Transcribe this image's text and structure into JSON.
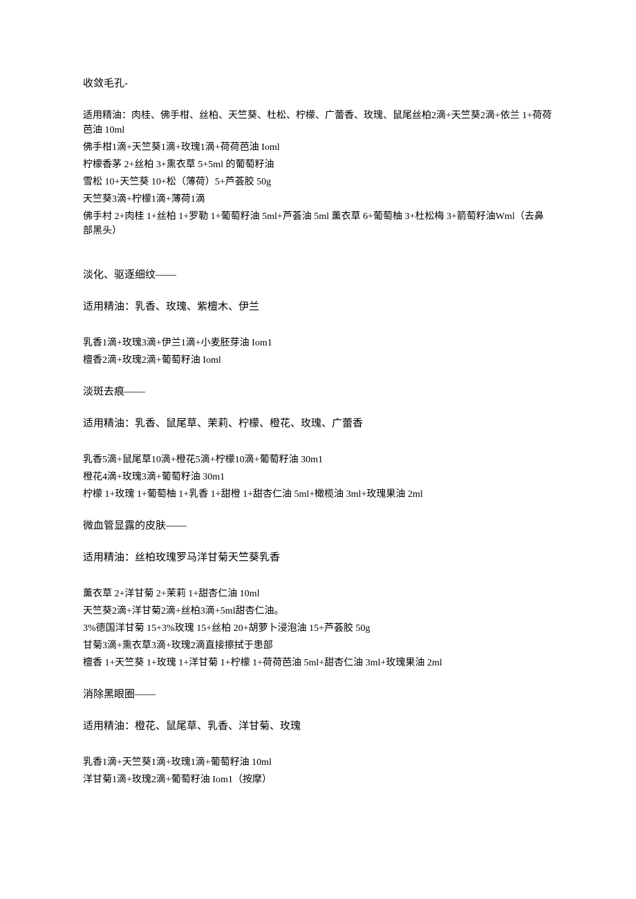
{
  "sections": [
    {
      "title": "收敛毛孔-",
      "intro": "适用精油：肉桂、佛手柑、丝柏、天竺葵、杜松、柠檬、广蕾香、玫瑰、鼠尾丝柏2滴+天竺葵2滴+依兰 1+荷荷芭油 10ml",
      "lines": [
        "佛手柑1滴+天竺葵1滴+玫瑰1滴+荷荷芭油 Ioml",
        "柠檬香茅 2+丝柏 3+熏衣草 5+5ml 的葡萄籽油",
        "雪松 10+天竺葵 10+松（薄荷）5+芦荟胶 50g",
        "天竺葵3滴+柠檬1滴+薄荷1滴",
        "佛手村 2+肉桂 1+丝柏 1+罗勒 1+葡萄籽油 5ml+芦荟油 5ml 薰衣草 6+葡萄柚 3+杜松梅 3+箭萄籽油Wml（去鼻部黑头）"
      ]
    },
    {
      "title": "淡化、驱逐细纹——",
      "intro": "适用精油：乳香、玫瑰、紫檀木、伊兰",
      "intro_spaced": true,
      "lines": [
        "乳香1滴+玫瑰3滴+伊兰1滴+小麦胚芽油 Iom1",
        "檀香2滴+玫瑰2滴+葡萄籽油 Ioml"
      ]
    },
    {
      "title": "淡斑去痕——",
      "intro": "适用精油：乳香、鼠尾草、茉莉、柠檬、橙花、玫瑰、广蕾香",
      "intro_spaced": true,
      "lines": [
        "乳香5滴+鼠尾草10滴+橙花5滴+柠檬10滴+葡萄籽油 30m1",
        "橙花4滴+玫瑰3滴+葡萄籽油 30m1",
        "柠檬 1+玫瑰 1+葡萄柚 1+乳香 1+甜橙 1+甜杏仁油 5ml+橄榄油 3ml+玫瑰果油 2ml"
      ]
    },
    {
      "title": "微血管显露的皮肤——",
      "intro": "适用精油：丝柏玫瑰罗马洋甘菊天竺葵乳香",
      "intro_spaced": true,
      "lines": [
        "薰衣草 2+洋甘菊 2+茉莉 1+甜杏仁油 10ml",
        "天竺葵2滴+洋甘菊2滴+丝柏3滴+5ml甜杏仁油。",
        "3%德国洋甘菊 15+3%玫瑰 15+丝柏 20+胡萝卜浸泡油 15+芦荟胶 50g",
        "甘菊3滴+熏衣草3滴+玫瑰2滴直接擦拭于患部",
        "檀香 1+天竺葵 1+玫瑰 1+洋甘菊 1+柠檬 1+荷荷芭油 5ml+甜杏仁油 3ml+玫瑰果油 2ml"
      ]
    },
    {
      "title": "消除黑眼圈——",
      "intro": "适用精油：橙花、鼠尾草、乳香、洋甘菊、玫瑰",
      "intro_spaced": true,
      "lines": [
        "乳香1滴+天竺葵1滴+玫瑰1滴+葡萄籽油 10ml",
        "洋甘菊1滴+玫瑰2滴+葡萄籽油 Iom1（按摩）"
      ]
    }
  ]
}
